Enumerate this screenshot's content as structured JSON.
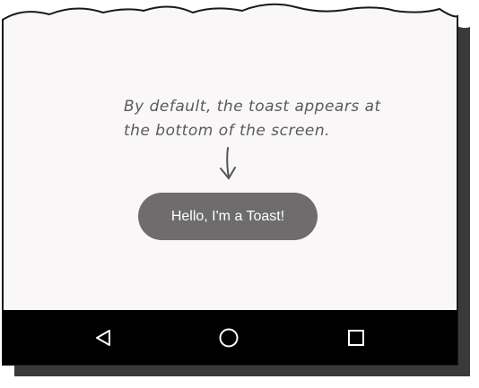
{
  "annotation": {
    "line1": "By default, the toast appears at",
    "line2": "the bottom of the screen."
  },
  "toast": {
    "message": "Hello, I'm a Toast!"
  },
  "navbar": {
    "buttons": [
      {
        "name": "back",
        "icon": "triangle-back-icon"
      },
      {
        "name": "home",
        "icon": "circle-home-icon"
      },
      {
        "name": "recents",
        "icon": "square-recents-icon"
      }
    ]
  },
  "colors": {
    "screen_background": "#f9f7f7",
    "toast_background": "#6e6c6c",
    "navbar_background": "#000000",
    "annotation_text": "#5a5a5a",
    "shadow": "#3a3a3a"
  }
}
